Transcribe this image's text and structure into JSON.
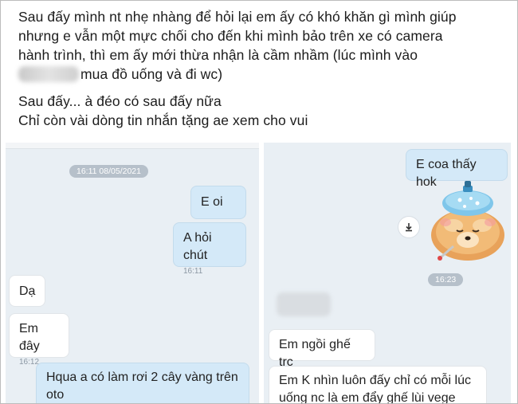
{
  "post": {
    "line1": "Sau đấy mình nt nhẹ nhàng để hỏi lại em ấy có khó khăn gì mình giúp",
    "line2": "nhưng e vẫn một mực chối cho đến khi mình bảo trên xe có camera",
    "line3": "hành trình, thì em ấy mới thừa nhận là cầm nhầm (lúc mình vào",
    "line4": "mua đồ uống và đi wc)",
    "line5": "Sau đấy... à đéo có sau đấy nữa",
    "line6": "Chỉ còn vài dòng tin nhắn  tặng ae xem cho vui"
  },
  "left_chat": {
    "date_stamp": "16:11 08/05/2021",
    "messages": [
      {
        "text": "E oi",
        "time": ""
      },
      {
        "text": "A hỏi chút",
        "time": "16:11"
      },
      {
        "text": "Dạ",
        "time": ""
      },
      {
        "text": "Em đây",
        "time": "16:12"
      },
      {
        "text": "Hqua a có làm rơi 2 cây vàng trên oto",
        "time": ""
      }
    ]
  },
  "right_chat": {
    "messages": [
      {
        "text": "E coa thấy hok",
        "time": ""
      },
      {
        "text": "Em ngồi ghế trc",
        "time": ""
      },
      {
        "text": "Em K nhìn luôn đấy chỉ có mỗi lúc uống nc là em đẩy ghế lùi vege",
        "time": ""
      }
    ],
    "sticker_time": "16:23",
    "sticker_icon": "pomeranian-ice-pack-sticker",
    "download_icon": "download-icon"
  },
  "colors": {
    "chat_bg": "#e9eff4",
    "outgoing_bubble": "#d4e9f8",
    "incoming_bubble": "#ffffff",
    "timestamp_bg": "#b6c0ca"
  }
}
